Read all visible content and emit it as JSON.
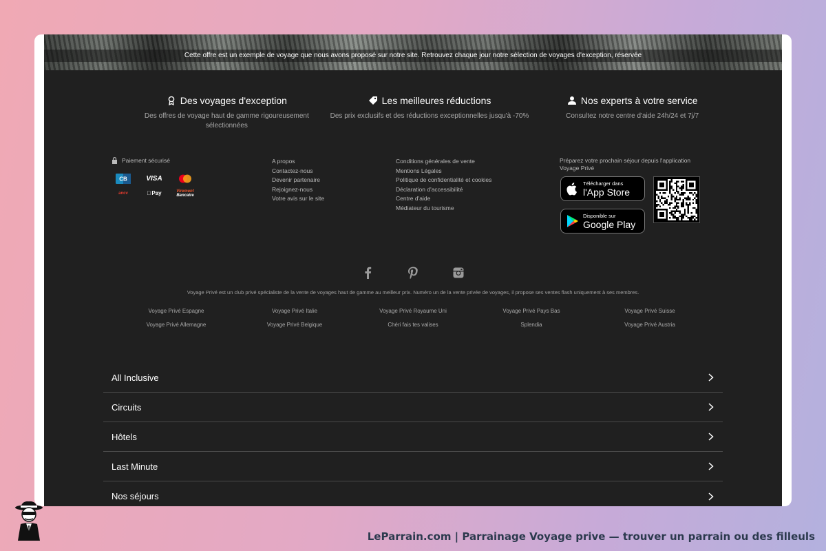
{
  "hero": {
    "caption": "Cette offre est un exemple de voyage que nous avons proposé sur notre site. Retrouvez chaque jour notre sélection de voyages d'exception, réservée"
  },
  "features": [
    {
      "title": "Des voyages d'exception",
      "desc": "Des offres de voyage haut de gamme rigoureusement sélectionnées",
      "icon": "award-icon"
    },
    {
      "title": "Les meilleures réductions",
      "desc": "Des prix exclusifs et des réductions exceptionnelles jusqu'à -70%",
      "icon": "tag-icon"
    },
    {
      "title": "Nos experts à votre service",
      "desc": "Consultez notre centre d'aide 24h/24 et 7j/7",
      "icon": "user-icon"
    }
  ],
  "payment": {
    "label": "Paiement sécurisé",
    "methods": [
      "CB",
      "VISA",
      "Mastercard",
      "ANCV",
      "Apple Pay",
      "Virement Bancaire"
    ],
    "visa": "VISA",
    "applepay": "Pay",
    "virement_1": "Virement",
    "virement_2": "Bancaire",
    "ancv": "ancv"
  },
  "company_links": [
    "A propos",
    "Contactez-nous",
    "Devenir partenaire",
    "Rejoignez-nous",
    "Votre avis sur le site"
  ],
  "legal_links": [
    "Conditions générales de vente",
    "Mentions Légales",
    "Politique de confidentialité et cookies",
    "Déclaration d'accessibilité",
    "Centre d'aide",
    "Médiateur du tourisme"
  ],
  "app": {
    "text": "Préparez votre prochain séjour depuis l'application Voyage Privé",
    "appstore_small": "Télécharger dans",
    "appstore_big": "l'App Store",
    "googleplay_small": "Disponible sur",
    "googleplay_big": "Google Play"
  },
  "social": [
    "facebook-icon",
    "pinterest-icon",
    "instagram-icon"
  ],
  "about": "Voyage Privé est un club privé spécialiste de la vente de voyages haut de gamme au meilleur prix. Numéro un de la vente privée de voyages, il propose ses ventes flash uniquement à ses membres.",
  "country_links": [
    "Voyage Privé Espagne",
    "Voyage Privé Italie",
    "Voyage Privé Royaume Uni",
    "Voyage Privé Pays Bas",
    "Voyage Privé Suisse",
    "Voyage Privé Allemagne",
    "Voyage Privé Belgique",
    "Chéri fais tes valises",
    "Splendia",
    "Voyage Privé Austria"
  ],
  "accordion": [
    "All Inclusive",
    "Circuits",
    "Hôtels",
    "Last Minute",
    "Nos séjours"
  ],
  "watermark": "LeParrain.com | Parrainage Voyage prive — trouver un parrain ou des filleuls",
  "colors": {
    "footer_bg": "#202020",
    "accent_text": "#ffffff",
    "watermark": "#2c3a4e"
  }
}
